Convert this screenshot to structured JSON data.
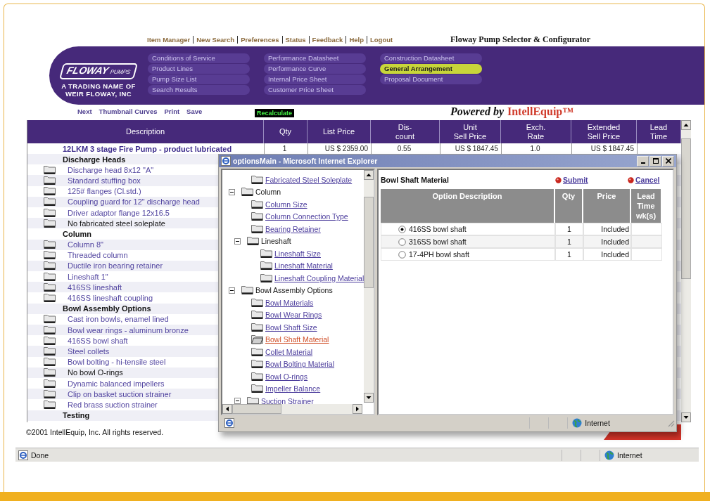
{
  "top_nav": [
    "Item Manager",
    "New Search",
    "Preferences",
    "Status",
    "Feedback",
    "Help",
    "Logout"
  ],
  "app_title": "Floway Pump Selector & Configurator",
  "logo": {
    "wordmark": "FLOWAY",
    "suffix": "PUMPS",
    "tagline": [
      "A TRADING NAME OF",
      "WEIR FLOWAY, INC"
    ]
  },
  "menu_columns": [
    [
      {
        "label": "Conditions of Service",
        "selected": false
      },
      {
        "label": "Product Lines",
        "selected": false
      },
      {
        "label": "Pump Size List",
        "selected": false
      },
      {
        "label": "Search Results",
        "selected": false
      }
    ],
    [
      {
        "label": "Performance Datasheet",
        "selected": false
      },
      {
        "label": "Performance Curve",
        "selected": false
      },
      {
        "label": "Internal Price Sheet",
        "selected": false
      },
      {
        "label": "Customer Price Sheet",
        "selected": false
      }
    ],
    [
      {
        "label": "Construction Datasheet",
        "selected": false
      },
      {
        "label": "General Arrangement",
        "selected": true
      },
      {
        "label": "Proposal Document",
        "selected": false
      }
    ]
  ],
  "toolbar_links": [
    "Next",
    "Thumbnail Curves",
    "Print",
    "Save"
  ],
  "recalculate": "Recalculate",
  "powered_by": {
    "prefix": "Powered by",
    "brand": "IntellEquip™"
  },
  "table": {
    "columns": [
      "Description",
      "Qty",
      "List Price",
      "Dis-\ncount",
      "Unit\nSell Price",
      "Exch.\nRate",
      "Extended\nSell Price",
      "Lead\nTime"
    ],
    "rows": [
      {
        "kind": "product",
        "description": "12LKM 3 stage Fire Pump - product lubricated",
        "cells": [
          "1",
          "US $ 2359.00",
          "0.55",
          "US $ 1847.45",
          "1.0",
          "US $ 1847.45"
        ]
      },
      {
        "kind": "section",
        "description": "Discharge Heads"
      },
      {
        "kind": "item",
        "description": "Discharge head 8x12 \"A\"",
        "included": true
      },
      {
        "kind": "item",
        "description": "Standard stuffing box",
        "included": true
      },
      {
        "kind": "item",
        "description": "125# flanges (Cl.std.)",
        "included": true
      },
      {
        "kind": "item",
        "description": "Coupling guard for 12\" discharge head",
        "included": true
      },
      {
        "kind": "item",
        "description": "Driver adaptor flange 12x16.5",
        "included": true
      },
      {
        "kind": "item",
        "description": "No fabricated steel soleplate",
        "included": false
      },
      {
        "kind": "section",
        "description": "Column"
      },
      {
        "kind": "item",
        "description": "Column 8\"",
        "included": true
      },
      {
        "kind": "item",
        "description": "Threaded column",
        "included": true
      },
      {
        "kind": "item",
        "description": "Ductile iron bearing retainer",
        "included": true
      },
      {
        "kind": "item",
        "description": "Lineshaft 1\"",
        "included": true
      },
      {
        "kind": "item",
        "description": "416SS lineshaft",
        "included": true
      },
      {
        "kind": "item",
        "description": "416SS lineshaft coupling",
        "included": true
      },
      {
        "kind": "section",
        "description": "Bowl Assembly Options"
      },
      {
        "kind": "item",
        "description": "Cast iron bowls, enamel lined",
        "included": true
      },
      {
        "kind": "item",
        "description": "Bowl wear rings - aluminum bronze",
        "included": true
      },
      {
        "kind": "item",
        "description": "416SS bowl shaft",
        "included": true
      },
      {
        "kind": "item",
        "description": "Steel collets",
        "included": true
      },
      {
        "kind": "item",
        "description": "Bowl bolting - hi-tensile steel",
        "included": true
      },
      {
        "kind": "item",
        "description": "No bowl O-rings",
        "included": false
      },
      {
        "kind": "item",
        "description": "Dynamic balanced impellers",
        "included": true
      },
      {
        "kind": "item",
        "description": "Clip on basket suction strainer",
        "included": true
      },
      {
        "kind": "item",
        "description": "Red brass suction strainer",
        "included": true
      },
      {
        "kind": "section",
        "description": "Testing"
      }
    ]
  },
  "footer": "©2001 IntellEquip, Inc.  All rights reserved.",
  "popup": {
    "title": "optionsMain - Microsoft Internet Explorer",
    "tree": [
      {
        "kind": "link",
        "label": "Fabricated Steel Soleplate",
        "selected": false
      },
      {
        "kind": "group",
        "label": "Column",
        "expanded": true,
        "children": [
          {
            "kind": "link",
            "label": "Column Size",
            "selected": false
          },
          {
            "kind": "link",
            "label": "Column Connection Type",
            "selected": false
          },
          {
            "kind": "link",
            "label": "Bearing Retainer",
            "selected": false
          },
          {
            "kind": "group",
            "label": "Lineshaft",
            "expanded": true,
            "children": [
              {
                "kind": "link",
                "label": "Lineshaft Size",
                "selected": false
              },
              {
                "kind": "link",
                "label": "Lineshaft Material",
                "selected": false
              },
              {
                "kind": "link",
                "label": "Lineshaft Coupling Material",
                "selected": false
              }
            ]
          }
        ]
      },
      {
        "kind": "group",
        "label": "Bowl Assembly Options",
        "expanded": true,
        "children": [
          {
            "kind": "link",
            "label": "Bowl Materials",
            "selected": false
          },
          {
            "kind": "link",
            "label": "Bowl Wear Rings",
            "selected": false
          },
          {
            "kind": "link",
            "label": "Bowl Shaft Size",
            "selected": false
          },
          {
            "kind": "link",
            "label": "Bowl Shaft Material",
            "selected": true
          },
          {
            "kind": "link",
            "label": "Collet Material",
            "selected": false
          },
          {
            "kind": "link",
            "label": "Bowl Bolting Material",
            "selected": false
          },
          {
            "kind": "link",
            "label": "Bowl O-rings",
            "selected": false
          },
          {
            "kind": "link",
            "label": "Impeller Balance",
            "selected": false
          },
          {
            "kind": "link_group",
            "label": "Suction Strainer",
            "expanded": true
          }
        ]
      }
    ],
    "panel": {
      "title": "Bowl Shaft Material",
      "actions": [
        "Submit",
        "Cancel"
      ],
      "columns": [
        "Option Description",
        "Qty",
        "Price",
        "Lead\nTime\nwk(s)"
      ],
      "rows": [
        {
          "label": "416SS bowl shaft",
          "qty": "1",
          "price": "Included",
          "selected": true
        },
        {
          "label": "316SS bowl shaft",
          "qty": "1",
          "price": "Included",
          "selected": false
        },
        {
          "label": "17-4PH bowl shaft",
          "qty": "1",
          "price": "Included",
          "selected": false
        }
      ]
    },
    "status_zone": "Internet"
  },
  "status_bar": {
    "text": "Done",
    "zone": "Internet"
  }
}
